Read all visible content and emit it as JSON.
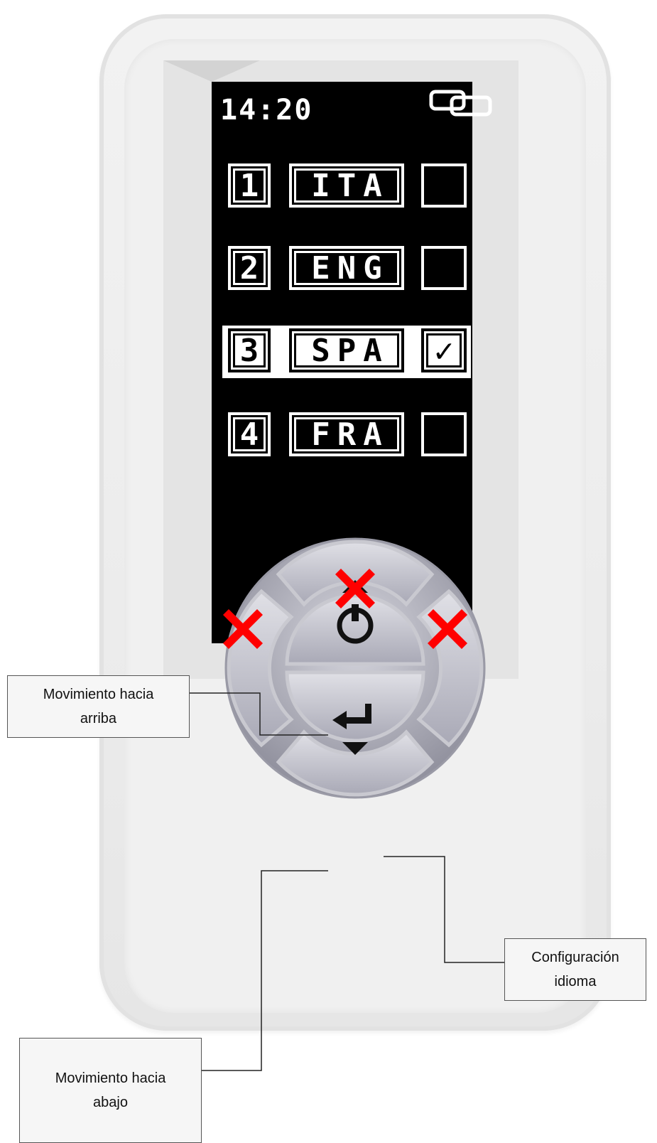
{
  "screen": {
    "time": "14:20",
    "rows": [
      {
        "number": "1",
        "language": "ITA",
        "checked": false
      },
      {
        "number": "2",
        "language": "ENG",
        "checked": false
      },
      {
        "number": "3",
        "language": "SPA",
        "checked": true
      },
      {
        "number": "4",
        "language": "FRA",
        "checked": false
      }
    ],
    "check_glyph": "✓"
  },
  "callouts": {
    "up": "Movimiento hacia arriba",
    "down": "Movimiento hacia abajo",
    "enter": "Configuración idioma"
  },
  "colors": {
    "screen_bg": "#000000",
    "screen_text": "#ffffff",
    "disabled_mark": "#ff0000",
    "button": "#b9b9c4"
  },
  "icons": {
    "up": "triangle-up-icon",
    "down": "triangle-down-icon",
    "enter": "enter-arrow-icon",
    "power": "power-icon",
    "link": "link-icon",
    "disabled": "red-x-icon"
  }
}
